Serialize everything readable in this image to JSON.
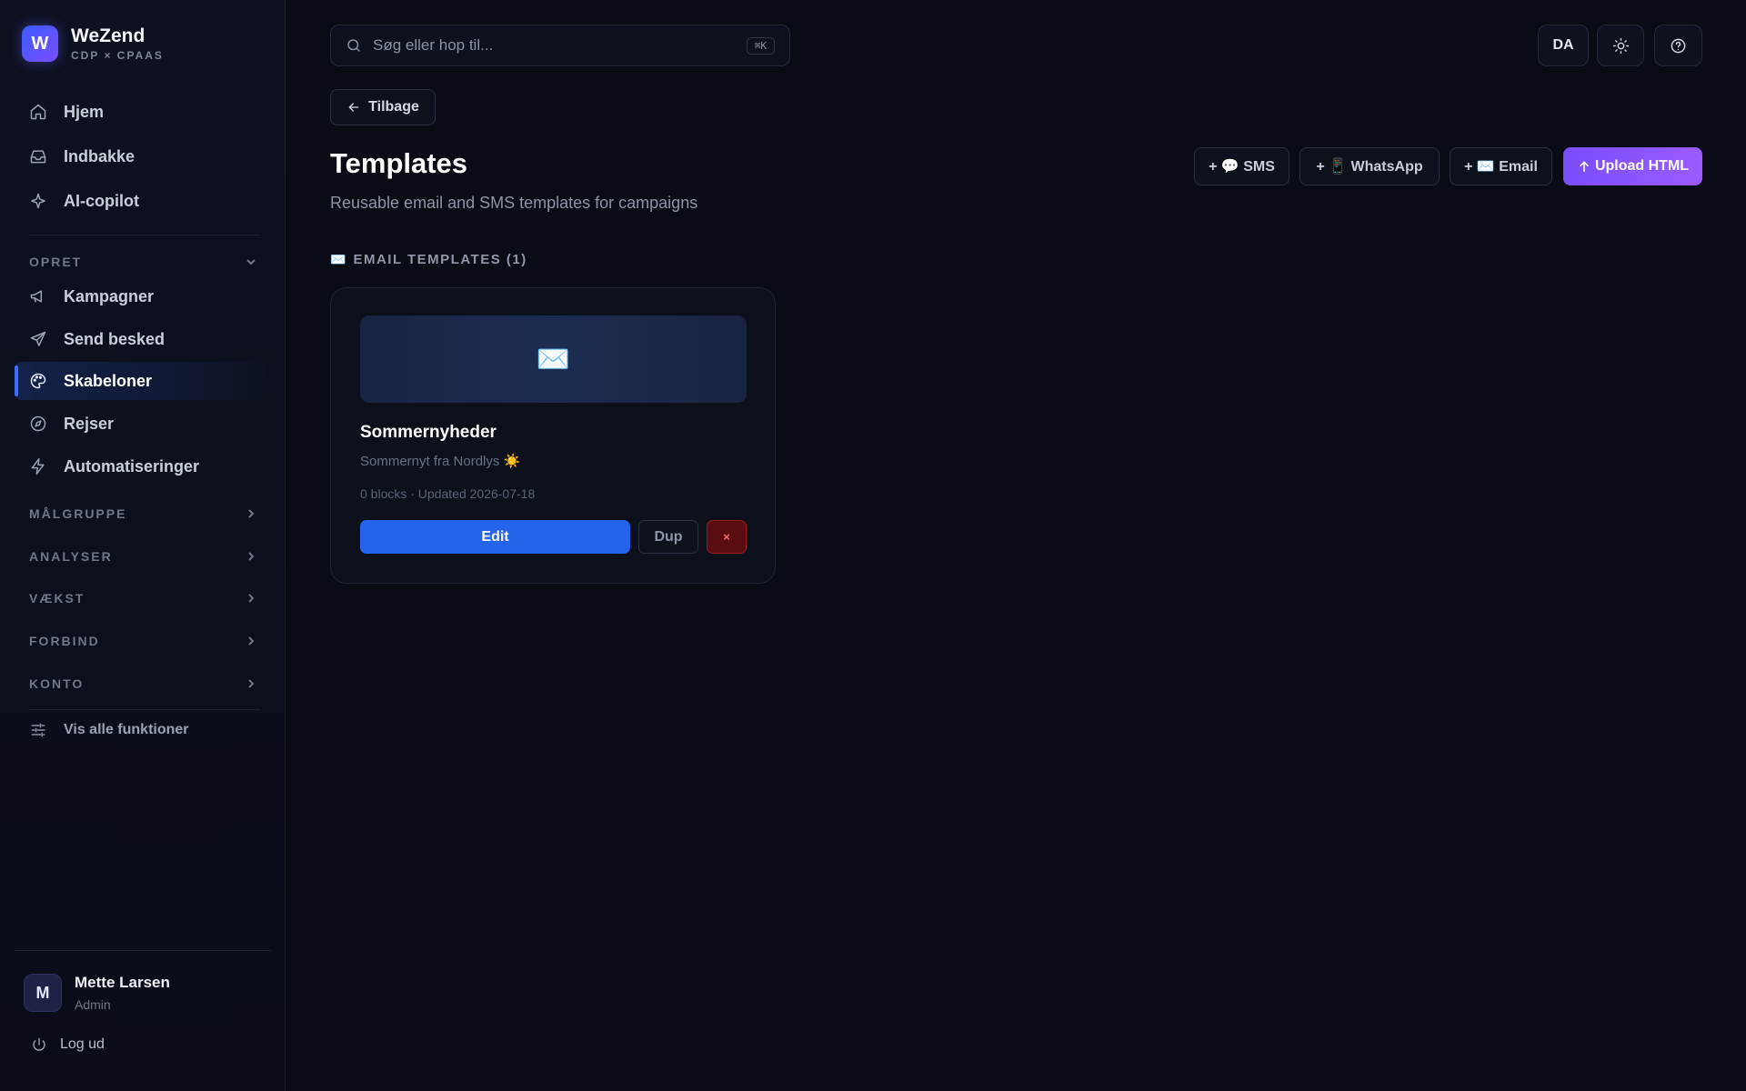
{
  "brand": {
    "logo_letter": "W",
    "name": "WeZend",
    "subtitle": "CDP × CPAAS"
  },
  "nav_primary": [
    {
      "label": "Hjem",
      "icon": "home-icon"
    },
    {
      "label": "Indbakke",
      "icon": "inbox-icon"
    },
    {
      "label": "AI-copilot",
      "icon": "sparkle-icon"
    }
  ],
  "sections": {
    "opret": "OPRET",
    "malgruppe": "MÅLGRUPPE",
    "analyser": "ANALYSER",
    "vaekst": "VÆKST",
    "forbind": "FORBIND",
    "konto": "KONTO"
  },
  "nav_opret": [
    {
      "label": "Kampagner",
      "icon": "megaphone-icon"
    },
    {
      "label": "Send besked",
      "icon": "send-icon"
    },
    {
      "label": "Skabeloner",
      "icon": "palette-icon",
      "active": true
    },
    {
      "label": "Rejser",
      "icon": "compass-icon"
    },
    {
      "label": "Automatiseringer",
      "icon": "lightning-icon"
    }
  ],
  "show_all": "Vis alle funktioner",
  "user": {
    "initial": "M",
    "name": "Mette Larsen",
    "role": "Admin"
  },
  "logout": "Log ud",
  "search": {
    "placeholder": "Søg eller hop til...",
    "shortcut": "⌘K"
  },
  "topbar": {
    "language": "DA"
  },
  "back_label": "Tilbage",
  "page": {
    "title": "Templates",
    "subtitle": "Reusable email and SMS templates for campaigns"
  },
  "actions": {
    "sms": "+ 💬 SMS",
    "whatsapp": "+ 📱 WhatsApp",
    "email": "+ ✉️ Email",
    "upload": "Upload HTML"
  },
  "email_group": {
    "icon": "✉️",
    "heading": "EMAIL TEMPLATES (1)"
  },
  "templates": [
    {
      "thumb_icon": "✉️",
      "name": "Sommernyheder",
      "subject": "Sommernyt fra Nordlys ☀️",
      "meta": "0 blocks · Updated 2026-07-18",
      "edit": "Edit",
      "dup": "Dup",
      "delete": "×"
    }
  ],
  "colors": {
    "accent": "#2563eb",
    "upload": "#8b55ff",
    "danger": "#9b1c1c",
    "bg": "#090c15"
  }
}
